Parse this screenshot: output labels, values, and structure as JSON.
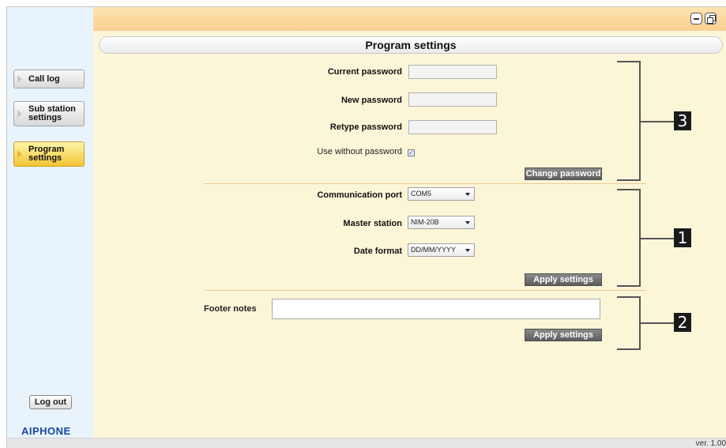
{
  "window": {
    "buttons": [
      {
        "icon": "minimize-icon"
      },
      {
        "icon": "restore-icon"
      }
    ]
  },
  "header": {
    "title": "Program settings"
  },
  "sidebar": {
    "items": [
      {
        "label_line1": "Call log",
        "label_line2": "",
        "active": false
      },
      {
        "label_line1": "Sub station",
        "label_line2": "settings",
        "active": false
      },
      {
        "label_line1": "Program",
        "label_line2": "settings",
        "active": true
      }
    ],
    "logout_label": "Log out",
    "logo": "AIPHONE"
  },
  "password_section": {
    "current_password_label": "Current password",
    "current_password_value": "",
    "new_password_label": "New password",
    "new_password_value": "",
    "retype_password_label": "Retype password",
    "retype_password_value": "",
    "use_without_password_label": "Use without password",
    "use_without_password_checked": true,
    "change_password_button": "Change password",
    "callout_number": "3"
  },
  "settings_section": {
    "communication_port_label": "Communication port",
    "communication_port_value": "COM5",
    "master_station_label": "Master station",
    "master_station_value": "NIM-20B",
    "date_format_label": "Date format",
    "date_format_value": "DD/MM/YYYY",
    "apply_button": "Apply settings",
    "callout_number": "1"
  },
  "footer_section": {
    "footer_notes_label": "Footer notes",
    "footer_notes_value": "",
    "apply_button": "Apply settings",
    "callout_number": "2"
  },
  "status": {
    "version": "ver. 1.00"
  },
  "colors": {
    "sidebar_bg": "#e8f3fb",
    "main_bg": "#fcf6d8",
    "topbar": "#f9cf8f",
    "active_nav": "#f3c433",
    "divider": "#f4c78b",
    "logo": "#1746a2"
  }
}
